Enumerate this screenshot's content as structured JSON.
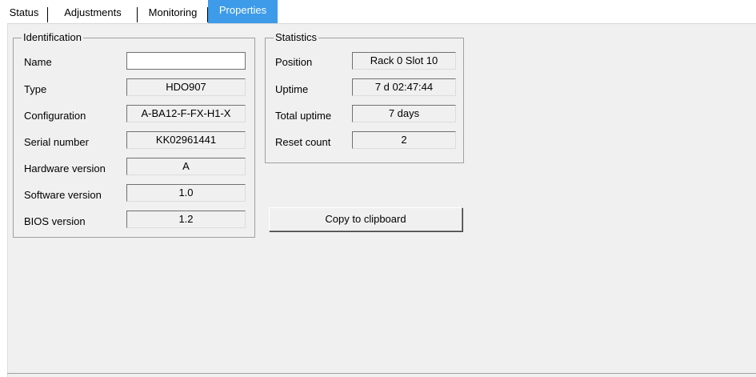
{
  "tabs": [
    {
      "label": "Status",
      "active": false
    },
    {
      "label": "Adjustments",
      "active": false
    },
    {
      "label": "Monitoring",
      "active": false
    },
    {
      "label": "Properties",
      "active": true
    }
  ],
  "identification": {
    "title": "Identification",
    "fields": [
      {
        "label": "Name",
        "value": ""
      },
      {
        "label": "Type",
        "value": "HDO907"
      },
      {
        "label": "Configuration",
        "value": "A-BA12-F-FX-H1-X"
      },
      {
        "label": "Serial number",
        "value": "KK02961441"
      },
      {
        "label": "Hardware version",
        "value": "A"
      },
      {
        "label": "Software version",
        "value": "1.0"
      },
      {
        "label": "BIOS version",
        "value": "1.2"
      }
    ]
  },
  "statistics": {
    "title": "Statistics",
    "fields": [
      {
        "label": "Position",
        "value": "Rack 0 Slot 10"
      },
      {
        "label": "Uptime",
        "value": "7 d 02:47:44"
      },
      {
        "label": "Total uptime",
        "value": "7 days"
      },
      {
        "label": "Reset count",
        "value": "2"
      }
    ]
  },
  "copy_button": {
    "label": "Copy to clipboard"
  },
  "colors": {
    "active_tab": "#3d9be9",
    "panel_bg": "#f0f0f0"
  }
}
